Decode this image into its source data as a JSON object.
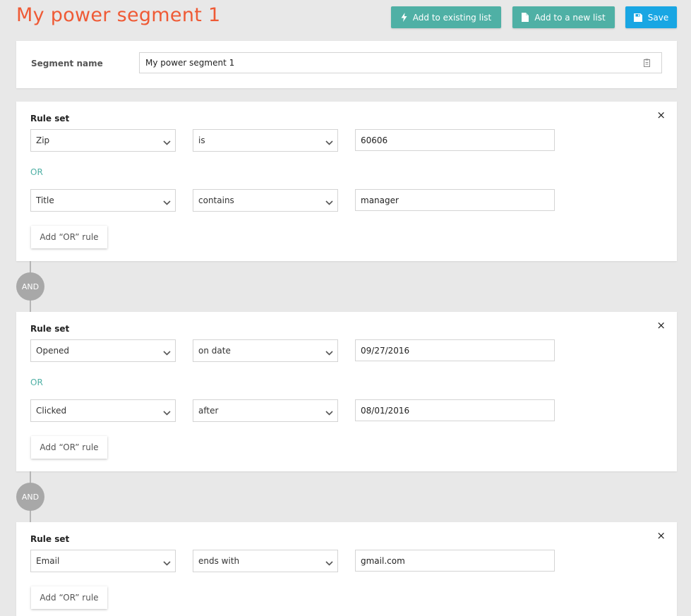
{
  "header": {
    "title": "My power segment 1",
    "buttons": {
      "add_existing": "Add to existing list",
      "add_new": "Add to a new list",
      "save": "Save"
    }
  },
  "segment": {
    "label": "Segment name",
    "value": "My power segment 1"
  },
  "rule_sets": [
    {
      "title": "Rule set",
      "close": "×",
      "rules": [
        {
          "field": "Zip",
          "operator": "is",
          "value": "60606"
        },
        {
          "field": "Title",
          "operator": "contains",
          "value": "manager"
        }
      ],
      "or_label": "OR",
      "add_or": "Add “OR” rule"
    },
    {
      "title": "Rule set",
      "close": "×",
      "rules": [
        {
          "field": "Opened",
          "operator": "on date",
          "value": "09/27/2016"
        },
        {
          "field": "Clicked",
          "operator": "after",
          "value": "08/01/2016"
        }
      ],
      "or_label": "OR",
      "add_or": "Add “OR” rule"
    },
    {
      "title": "Rule set",
      "close": "×",
      "rules": [
        {
          "field": "Email",
          "operator": "ends with",
          "value": "gmail.com"
        }
      ],
      "add_or": "Add “OR” rule"
    }
  ],
  "and_label": "AND",
  "icons": {
    "add_existing": "bolt-icon",
    "add_new": "file-icon",
    "save": "floppy-icon",
    "segment_input": "clipboard-icon",
    "select": "chevron-down-icon",
    "close": "close-icon"
  },
  "colors": {
    "title": "#ef5a35",
    "teal": "#4fb0a5",
    "save": "#19a6e3",
    "and_circle": "#a8a8a8"
  }
}
